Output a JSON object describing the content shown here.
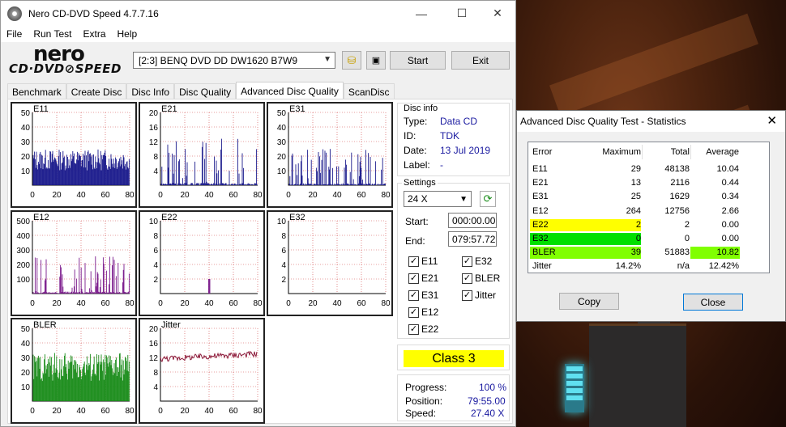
{
  "window": {
    "title": "Nero CD-DVD Speed 4.7.7.16",
    "minimize": "—",
    "maximize": "☐",
    "close": "✕"
  },
  "menu": [
    "File",
    "Run Test",
    "Extra",
    "Help"
  ],
  "logo": {
    "line1": "nero",
    "line2": "CD·DVD⊘SPEED"
  },
  "toolbar": {
    "drive": "[2:3]   BENQ DVD DD DW1620 B7W9",
    "start_label": "Start",
    "exit_label": "Exit"
  },
  "tabs": [
    "Benchmark",
    "Create Disc",
    "Disc Info",
    "Disc Quality",
    "Advanced Disc Quality",
    "ScanDisc"
  ],
  "active_tab": "Advanced Disc Quality",
  "charts": [
    {
      "id": "e11",
      "label": "E11",
      "yticks": [
        "50",
        "40",
        "30",
        "20",
        "10"
      ],
      "xticks": [
        "0",
        "20",
        "40",
        "60",
        "80"
      ],
      "color": "#1a1a8c",
      "max": 29
    },
    {
      "id": "e21",
      "label": "E21",
      "yticks": [
        "20",
        "16",
        "12",
        "8",
        "4"
      ],
      "xticks": [
        "0",
        "20",
        "40",
        "60",
        "80"
      ],
      "color": "#1a1a8c",
      "max": 13
    },
    {
      "id": "e31",
      "label": "E31",
      "yticks": [
        "50",
        "40",
        "30",
        "20",
        "10"
      ],
      "xticks": [
        "0",
        "20",
        "40",
        "60",
        "80"
      ],
      "color": "#1a1a8c",
      "max": 25
    },
    {
      "id": "e12",
      "label": "E12",
      "yticks": [
        "500",
        "400",
        "300",
        "200",
        "100"
      ],
      "xticks": [
        "0",
        "20",
        "40",
        "60",
        "80"
      ],
      "color": "#7a1a8c",
      "max": 264
    },
    {
      "id": "e22",
      "label": "E22",
      "yticks": [
        "10",
        "8",
        "6",
        "4",
        "2"
      ],
      "xticks": [
        "0",
        "20",
        "40",
        "60",
        "80"
      ],
      "color": "#7a1a8c",
      "max": 2
    },
    {
      "id": "e32",
      "label": "E32",
      "yticks": [
        "10",
        "8",
        "6",
        "4",
        "2"
      ],
      "xticks": [
        "0",
        "20",
        "40",
        "60",
        "80"
      ],
      "color": "#7a1a8c",
      "max": 0
    },
    {
      "id": "bler",
      "label": "BLER",
      "yticks": [
        "50",
        "40",
        "30",
        "20",
        "10"
      ],
      "xticks": [
        "0",
        "20",
        "40",
        "60",
        "80"
      ],
      "color": "#1a8c1a",
      "max": 39
    },
    {
      "id": "jitter",
      "label": "Jitter",
      "yticks": [
        "20",
        "16",
        "12",
        "8",
        "4"
      ],
      "xticks": [
        "0",
        "20",
        "40",
        "60",
        "80"
      ],
      "color": "#8c1a3a",
      "max": 14.2
    }
  ],
  "disc_info": {
    "title": "Disc info",
    "type_label": "Type:",
    "type": "Data CD",
    "id_label": "ID:",
    "id": "TDK",
    "date_label": "Date:",
    "date": "13 Jul 2019",
    "label_label": "Label:",
    "label": "-"
  },
  "settings": {
    "title": "Settings",
    "speed": "24 X",
    "start_label": "Start:",
    "start": "000:00.00",
    "end_label": "End:",
    "end": "079:57.72",
    "checks": [
      {
        "label": "E11",
        "checked": true
      },
      {
        "label": "E32",
        "checked": true
      },
      {
        "label": "E21",
        "checked": true
      },
      {
        "label": "BLER",
        "checked": true
      },
      {
        "label": "E31",
        "checked": true
      },
      {
        "label": "Jitter",
        "checked": true
      },
      {
        "label": "E12",
        "checked": true
      },
      {
        "label": "E22",
        "checked": true
      }
    ]
  },
  "class_label": "Class 3",
  "progress": {
    "progress_label": "Progress:",
    "progress": "100 %",
    "position_label": "Position:",
    "position": "79:55.00",
    "speed_label": "Speed:",
    "speed": "27.40 X"
  },
  "stats": {
    "title": "Advanced Disc Quality Test - Statistics",
    "headers": [
      "Error",
      "Maximum",
      "Total",
      "Average"
    ],
    "rows": [
      {
        "name": "E11",
        "max": "29",
        "total": "48138",
        "avg": "10.04"
      },
      {
        "name": "E21",
        "max": "13",
        "total": "2116",
        "avg": "0.44"
      },
      {
        "name": "E31",
        "max": "25",
        "total": "1629",
        "avg": "0.34"
      },
      {
        "name": "E12",
        "max": "264",
        "total": "12756",
        "avg": "2.66"
      },
      {
        "name": "E22",
        "max": "2",
        "total": "2",
        "avg": "0.00"
      },
      {
        "name": "E32",
        "max": "0",
        "total": "0",
        "avg": "0.00"
      },
      {
        "name": "BLER",
        "max": "39",
        "total": "51883",
        "avg": "10.82"
      },
      {
        "name": "Jitter",
        "max": "14.2%",
        "total": "n/a",
        "avg": "12.42%"
      }
    ],
    "copy_label": "Copy",
    "close_label": "Close"
  },
  "colors": {
    "yellow": "#ffff00",
    "green": "#00e000",
    "lime": "#80ff00"
  }
}
